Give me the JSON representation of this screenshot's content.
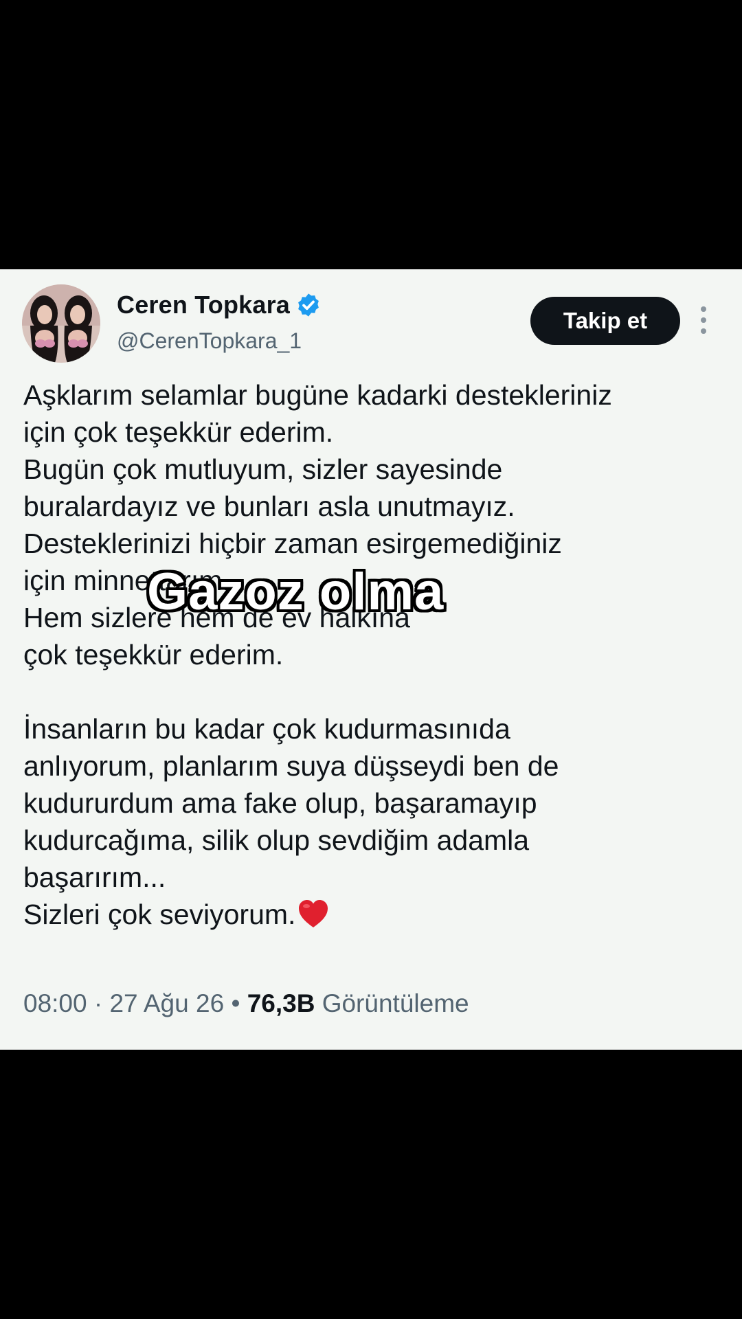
{
  "tweet": {
    "display_name": "Ceren Topkara",
    "handle": "@CerenTopkara_1",
    "follow_label": "Takip et",
    "body_lines": [
      "Aşklarım selamlar bugüne kadarki destekleriniz",
      "için çok teşekkür ederim.",
      "Bugün çok mutluyum, sizler sayesinde",
      "buralardayız ve bunları asla unutmayız.",
      "Desteklerinizi hiçbir zaman esirgemediğiniz",
      "için minnettarım.",
      "Hem sizlere hem de ev halkına",
      "çok teşekkür ederim.",
      "İnsanların bu kadar çok kudurmasınıda",
      "anlıyorum, planlarım suya düşseydi ben de",
      "kudururdum ama fake olup, başaramayıp",
      "kudurcağıma, silik olup sevdiğim adamla",
      "başarırım...",
      "Sizleri çok seviyorum."
    ],
    "time": "08:00",
    "date": "27 Ağu 26",
    "separator": "·",
    "bullet": "•",
    "views_count": "76,3B",
    "views_label": "Görüntüleme"
  },
  "overlay": {
    "caption": "Gazoz olma"
  },
  "icons": {
    "verified": "verified-badge-icon",
    "more": "more-vertical-icon",
    "heart": "red-heart-icon"
  },
  "colors": {
    "card_background": "#f3f6f3",
    "verified_blue": "#1d9bf0",
    "follow_button": "#0f1419",
    "secondary_text": "#536471",
    "heart_red": "#e0202e"
  }
}
